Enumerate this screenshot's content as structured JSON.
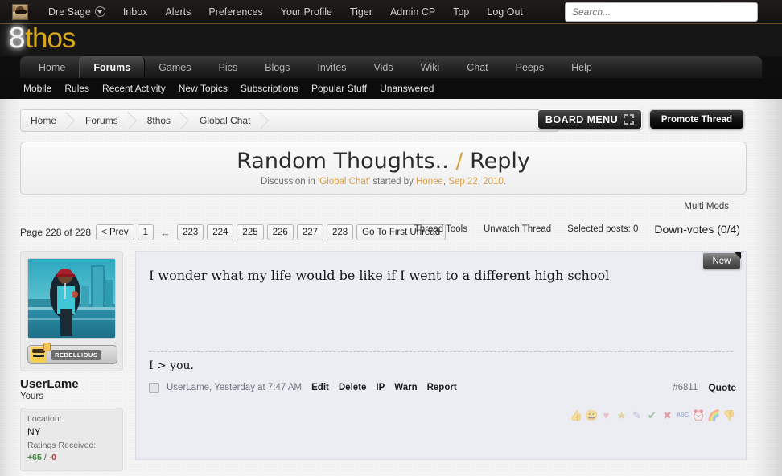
{
  "userbar": {
    "avatar_name": "user-avatar-thumb",
    "username": "Dre Sage",
    "links": [
      "Inbox",
      "Alerts",
      "Preferences",
      "Your Profile",
      "Tiger",
      "Admin CP",
      "Top",
      "Log Out"
    ],
    "search_placeholder": "Search...",
    "search_value": ""
  },
  "logo": {
    "mark": "8",
    "word": "thos"
  },
  "nav": {
    "tabs": [
      "Home",
      "Forums",
      "Games",
      "Pics",
      "Blogs",
      "Invites",
      "Vids",
      "Wiki",
      "Chat",
      "Peeps",
      "Help"
    ],
    "active": "Forums"
  },
  "subnav": {
    "links": [
      "Mobile",
      "Rules",
      "Recent Activity",
      "New Topics",
      "Subscriptions",
      "Popular Stuff",
      "Unanswered"
    ]
  },
  "breadcrumb": {
    "items": [
      "Home",
      "Forums",
      "8thos",
      "Global Chat"
    ]
  },
  "board_menu": {
    "label": "BOARD MENU"
  },
  "promote": {
    "label": "Promote Thread"
  },
  "thread": {
    "title": "Random Thoughts..",
    "separator": "/",
    "action": "Reply",
    "sub_prefix": "Discussion in",
    "forum": "'Global Chat'",
    "sub_mid": "started by",
    "author": "Honee",
    "date": "Sep 22, 2010",
    "sub_suffix": "."
  },
  "multi_mods": {
    "label": "Multi Mods"
  },
  "pagination": {
    "page_label": "Page 228 of 228",
    "prev": "< Prev",
    "first": "1",
    "ellipsis": "←",
    "pages": [
      "223",
      "224",
      "225",
      "226",
      "227",
      "228"
    ],
    "goto_unread": "Go To First Unread"
  },
  "tools": {
    "thread_tools": "Thread Tools",
    "unwatch": "Unwatch Thread",
    "selected_posts": "Selected posts: 0",
    "down_votes": "Down-votes (0/4)"
  },
  "post": {
    "new_flag": "New",
    "message": "I wonder what my life would be like if I went to a different high school",
    "signature": "I > you.",
    "meta": "UserLame, Yesterday at 7:47 AM",
    "actions": [
      "Edit",
      "Delete",
      "IP",
      "Warn",
      "Report"
    ],
    "post_id": "#6811",
    "quote": "Quote",
    "rating_icons": [
      "thumbs-up-icon",
      "smiley-icon",
      "heart-icon",
      "star-icon",
      "paintbrush-icon",
      "check-icon",
      "x-icon",
      "abc-spellcheck-icon",
      "clock-icon",
      "rainbow-icon",
      "thumbs-down-icon"
    ],
    "rating_glyphs": [
      "👍",
      "😀",
      "♥",
      "★",
      "✎",
      "✔",
      "✖",
      "ABC",
      "⏰",
      "🌈",
      "👎"
    ]
  },
  "user": {
    "name": "UserLame",
    "title": "Yours",
    "rank_badge": "REBELLIOUS",
    "location_label": "Location:",
    "location_value": "NY",
    "ratings_label": "Ratings Received:",
    "ratings_positive": "+65",
    "ratings_sep": "/",
    "ratings_negative": "-0"
  },
  "colors": {
    "accent_gold": "#d8a04a",
    "logo_gold": "#d8a81d",
    "post_bg": "#ecedf3",
    "positive": "#3a8a3a",
    "negative": "#b33a3a"
  }
}
